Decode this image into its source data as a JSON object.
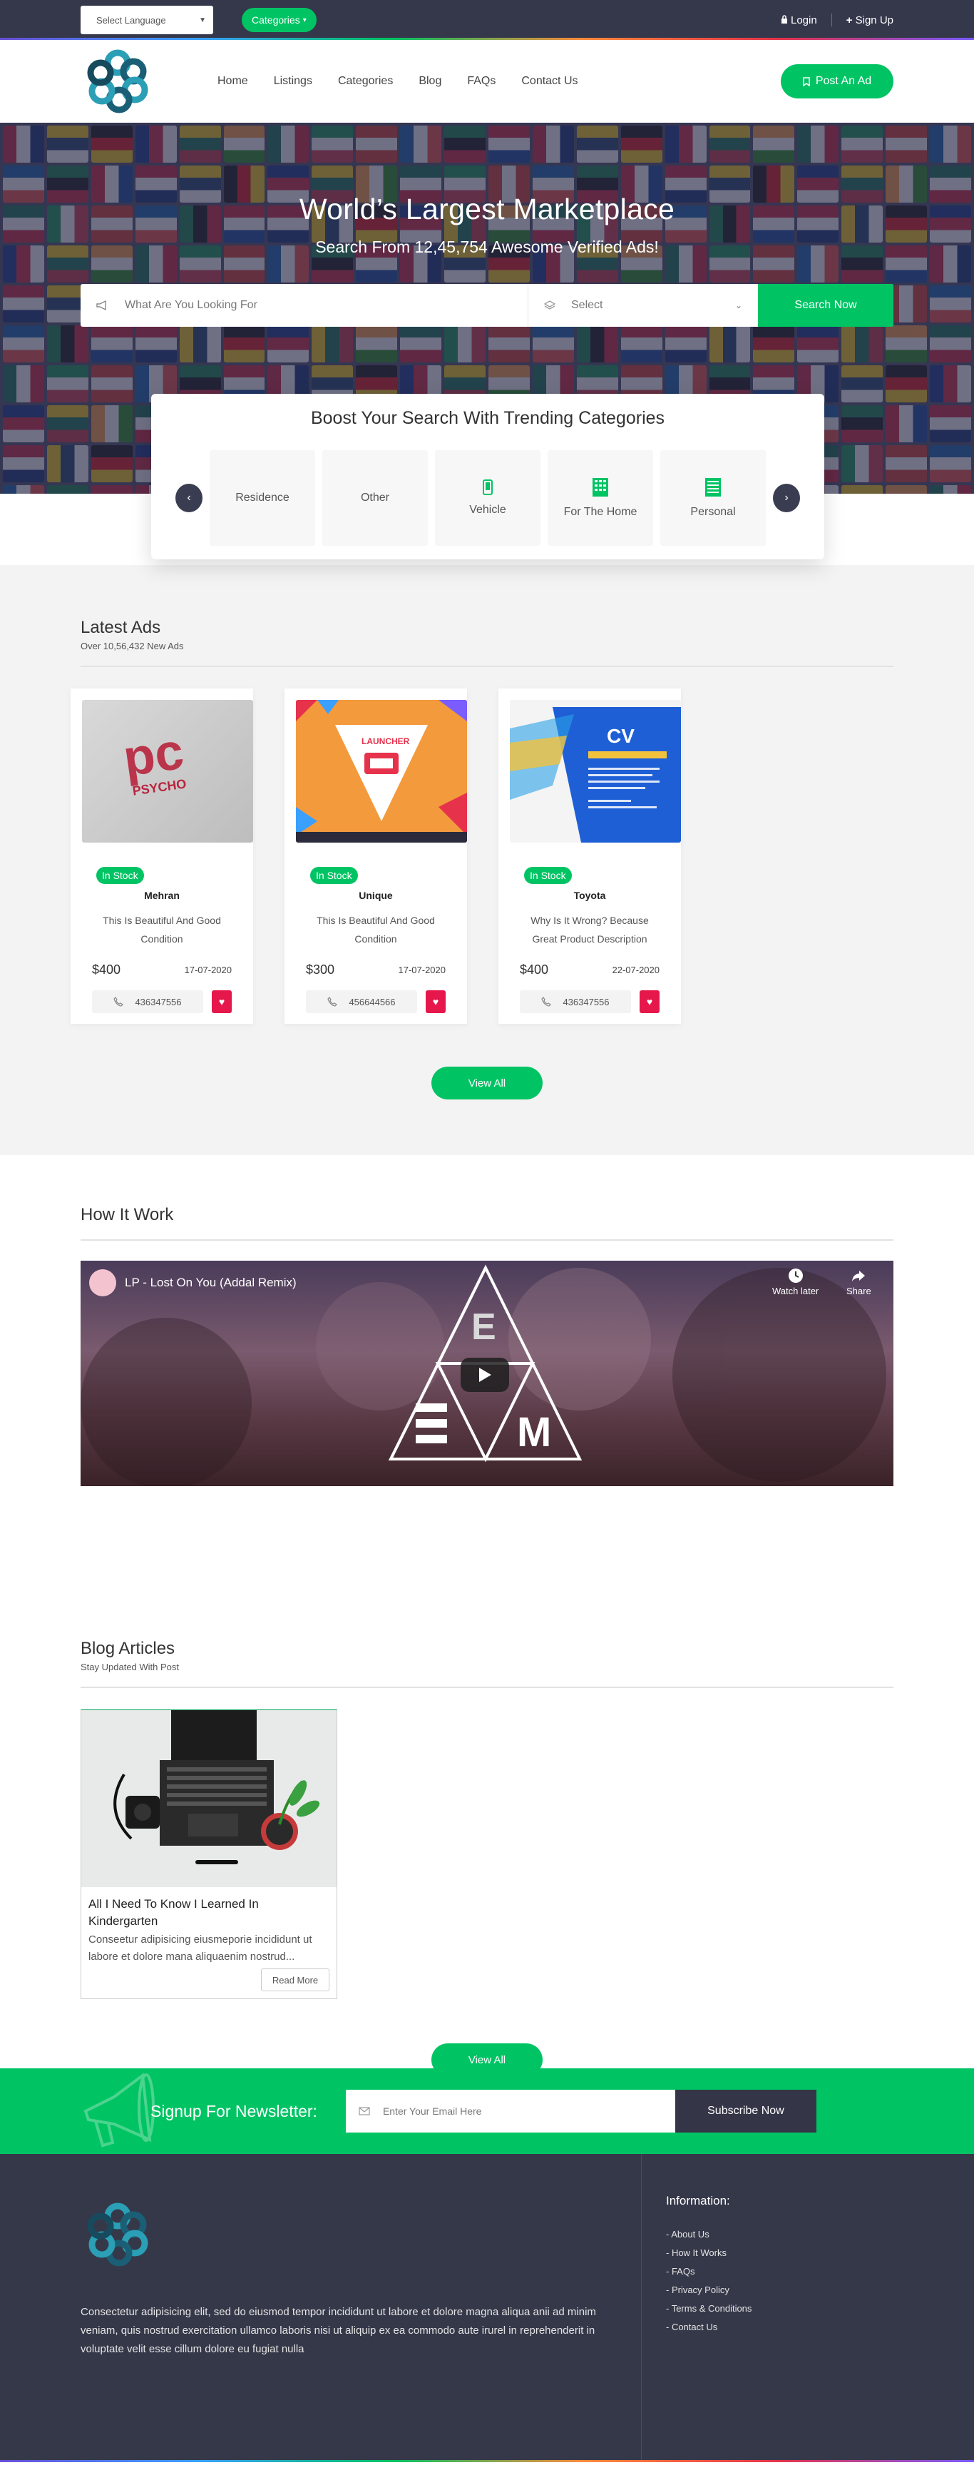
{
  "topbar": {
    "language_placeholder": "Select Language",
    "categories_label": "Categories",
    "login_label": "Login",
    "signup_label": "Sign Up"
  },
  "header": {
    "nav": [
      "Home",
      "Listings",
      "Categories",
      "Blog",
      "FAQs",
      "Contact Us"
    ],
    "post_ad_label": "Post An Ad"
  },
  "hero": {
    "title": "World’s Largest Marketplace",
    "subtitle": "Search From 12,45,754 Awesome Verified Ads!",
    "search_placeholder": "What Are You Looking For",
    "select_label": "Select",
    "search_button": "Search Now"
  },
  "trending": {
    "title": "Boost Your Search With Trending Categories",
    "items": [
      "Residence",
      "Other",
      "Vehicle",
      "For The Home",
      "Personal"
    ]
  },
  "latest": {
    "title": "Latest Ads",
    "subtitle": "Over 10,56,432 New Ads",
    "ads": [
      {
        "badge": "In Stock",
        "name": "Mehran",
        "desc": "This Is Beautiful And Good Condition",
        "price": "$400",
        "date": "17-07-2020",
        "phone": "436347556",
        "img_text": "PSYCHO"
      },
      {
        "badge": "In Stock",
        "name": "Unique",
        "desc": "This Is Beautiful And Good Condition",
        "price": "$300",
        "date": "17-07-2020",
        "phone": "456644566",
        "img_text": "LAUNCHER"
      },
      {
        "badge": "In Stock",
        "name": "Toyota",
        "desc": "Why Is It Wrong? Because Great Product Description",
        "price": "$400",
        "date": "22-07-2020",
        "phone": "436347556",
        "img_text": "CV"
      }
    ],
    "view_all": "View All"
  },
  "how": {
    "title": "How It Work",
    "video_title": "LP - Lost On You (Addal Remix)",
    "watch_later": "Watch later",
    "share": "Share"
  },
  "blog": {
    "title": "Blog Articles",
    "subtitle": "Stay Updated With Post",
    "post_title": "All I Need To Know I Learned In Kindergarten",
    "post_excerpt": "Conseetur adipisicing eiusmeporie incididunt ut labore et dolore mana aliquaenim nostrud...",
    "read_more": "Read More",
    "view_all": "View All"
  },
  "newsletter": {
    "title": "Signup For Newsletter:",
    "placeholder": "Enter Your Email Here",
    "button": "Subscribe Now"
  },
  "footer": {
    "about": "Consectetur adipisicing elit, sed do eiusmod tempor incididunt ut labore et dolore magna aliqua anii ad minim veniam, quis nostrud exercitation ullamco laboris nisi ut aliquip ex ea commodo aute irurel in reprehenderit in voluptate velit esse cillum dolore eu fugiat nulla",
    "info_title": "Information:",
    "links": [
      "- About Us",
      "- How It Works",
      "- FAQs",
      "- Privacy Policy",
      "- Terms & Conditions",
      "- Contact Us"
    ]
  },
  "colors": {
    "accent": "#00c464",
    "dark": "#35384b",
    "heart": "#e6174a"
  }
}
